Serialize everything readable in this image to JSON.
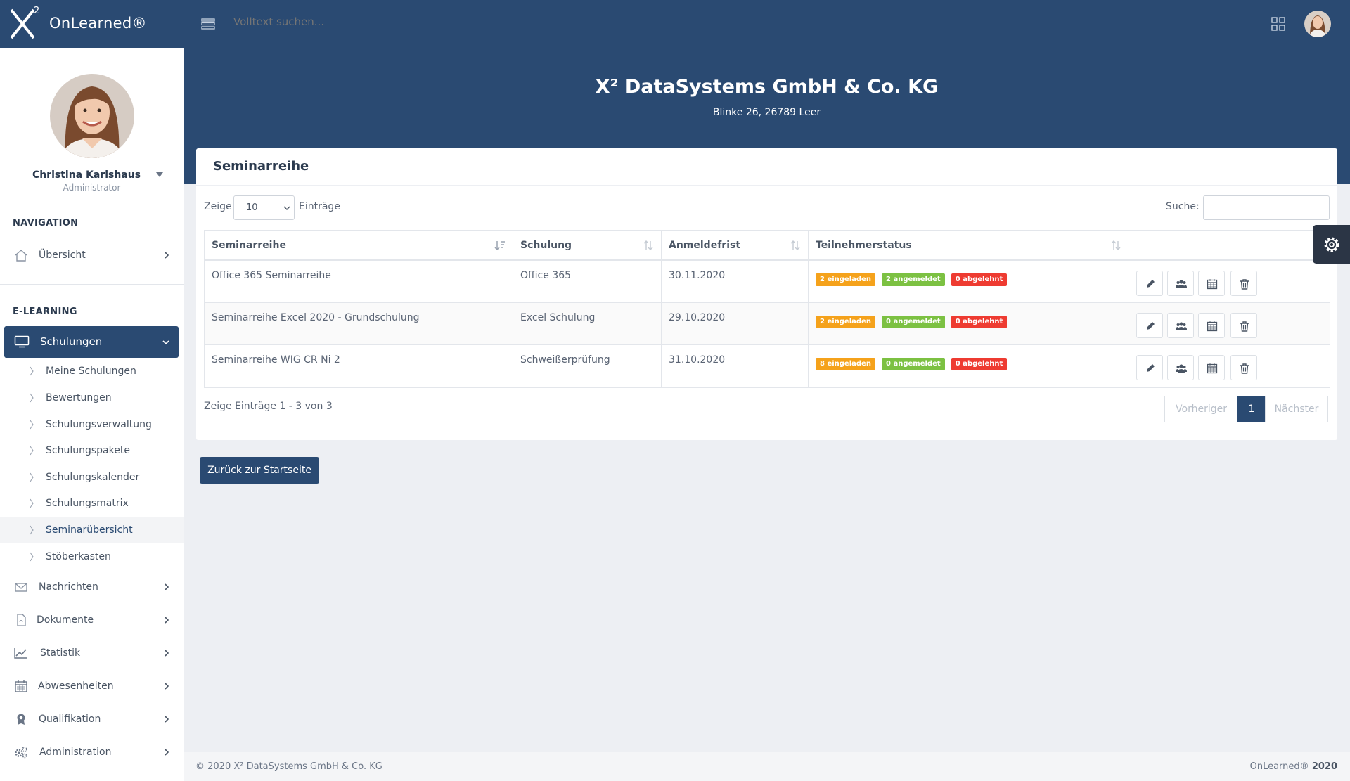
{
  "app": {
    "brand_superscript": "2",
    "brand_name": "OnLearned®",
    "search_placeholder": "Volltext suchen..."
  },
  "hero": {
    "company": "X² DataSystems GmbH & Co. KG",
    "address": "Blinke 26, 26789 Leer"
  },
  "profile": {
    "name": "Christina Karlshaus",
    "role": "Administrator"
  },
  "sidebar": {
    "nav_heading": "NAVIGATION",
    "overview": "Übersicht",
    "elearning_heading": "E-LEARNING",
    "active_item": "Schulungen",
    "sub_items": [
      "Meine Schulungen",
      "Bewertungen",
      "Schulungsverwaltung",
      "Schulungspakete",
      "Schulungskalender",
      "Schulungsmatrix",
      "Seminarübersicht",
      "Stöberkasten"
    ],
    "items": [
      {
        "label": "Nachrichten",
        "icon": "envelope-icon"
      },
      {
        "label": "Dokumente",
        "icon": "pdf-document-icon"
      },
      {
        "label": "Statistik",
        "icon": "line-chart-icon"
      },
      {
        "label": "Abwesenheiten",
        "icon": "calendar-icon"
      },
      {
        "label": "Qualifikation",
        "icon": "certificate-icon"
      },
      {
        "label": "Administration",
        "icon": "cogs-icon"
      }
    ]
  },
  "card": {
    "title": "Seminarreihe",
    "show_label": "Zeige",
    "entries_value": "10",
    "entries_label": "Einträge",
    "search_label": "Suche:",
    "search_value": "",
    "info": "Zeige Einträge 1 - 3 von 3",
    "prev": "Vorheriger",
    "page": "1",
    "next": "Nächster"
  },
  "table": {
    "headers": [
      "Seminarreihe",
      "Schulung",
      "Anmeldefrist",
      "Teilnehmerstatus",
      ""
    ],
    "rows": [
      {
        "seminarreihe": "Office 365 Seminarreihe",
        "schulung": "Office 365",
        "anmeldefrist": "30.11.2020",
        "eingeladen": "2 eingeladen",
        "angemeldet": "2 angemeldet",
        "abgelehnt": "0 abgelehnt"
      },
      {
        "seminarreihe": "Seminarreihe Excel 2020 - Grundschulung",
        "schulung": "Excel Schulung",
        "anmeldefrist": "29.10.2020",
        "eingeladen": "2 eingeladen",
        "angemeldet": "0 angemeldet",
        "abgelehnt": "0 abgelehnt"
      },
      {
        "seminarreihe": "Seminarreihe WIG CR Ni 2",
        "schulung": "Schweißerprüfung",
        "anmeldefrist": "31.10.2020",
        "eingeladen": "8 eingeladen",
        "angemeldet": "0 angemeldet",
        "abgelehnt": "0 abgelehnt"
      }
    ],
    "actions": [
      "pencil-icon",
      "users-icon",
      "calendar-icon",
      "trash-icon"
    ]
  },
  "back_button": "Zurück zur Startseite",
  "footer": {
    "left": "© 2020 X² DataSystems GmbH & Co. KG",
    "right_brand": "OnLearned®",
    "right_year": "2020"
  },
  "colors": {
    "primary": "#2a4a72",
    "orange": "#f5a21b",
    "green": "#7cc142",
    "red": "#ee3b31"
  }
}
